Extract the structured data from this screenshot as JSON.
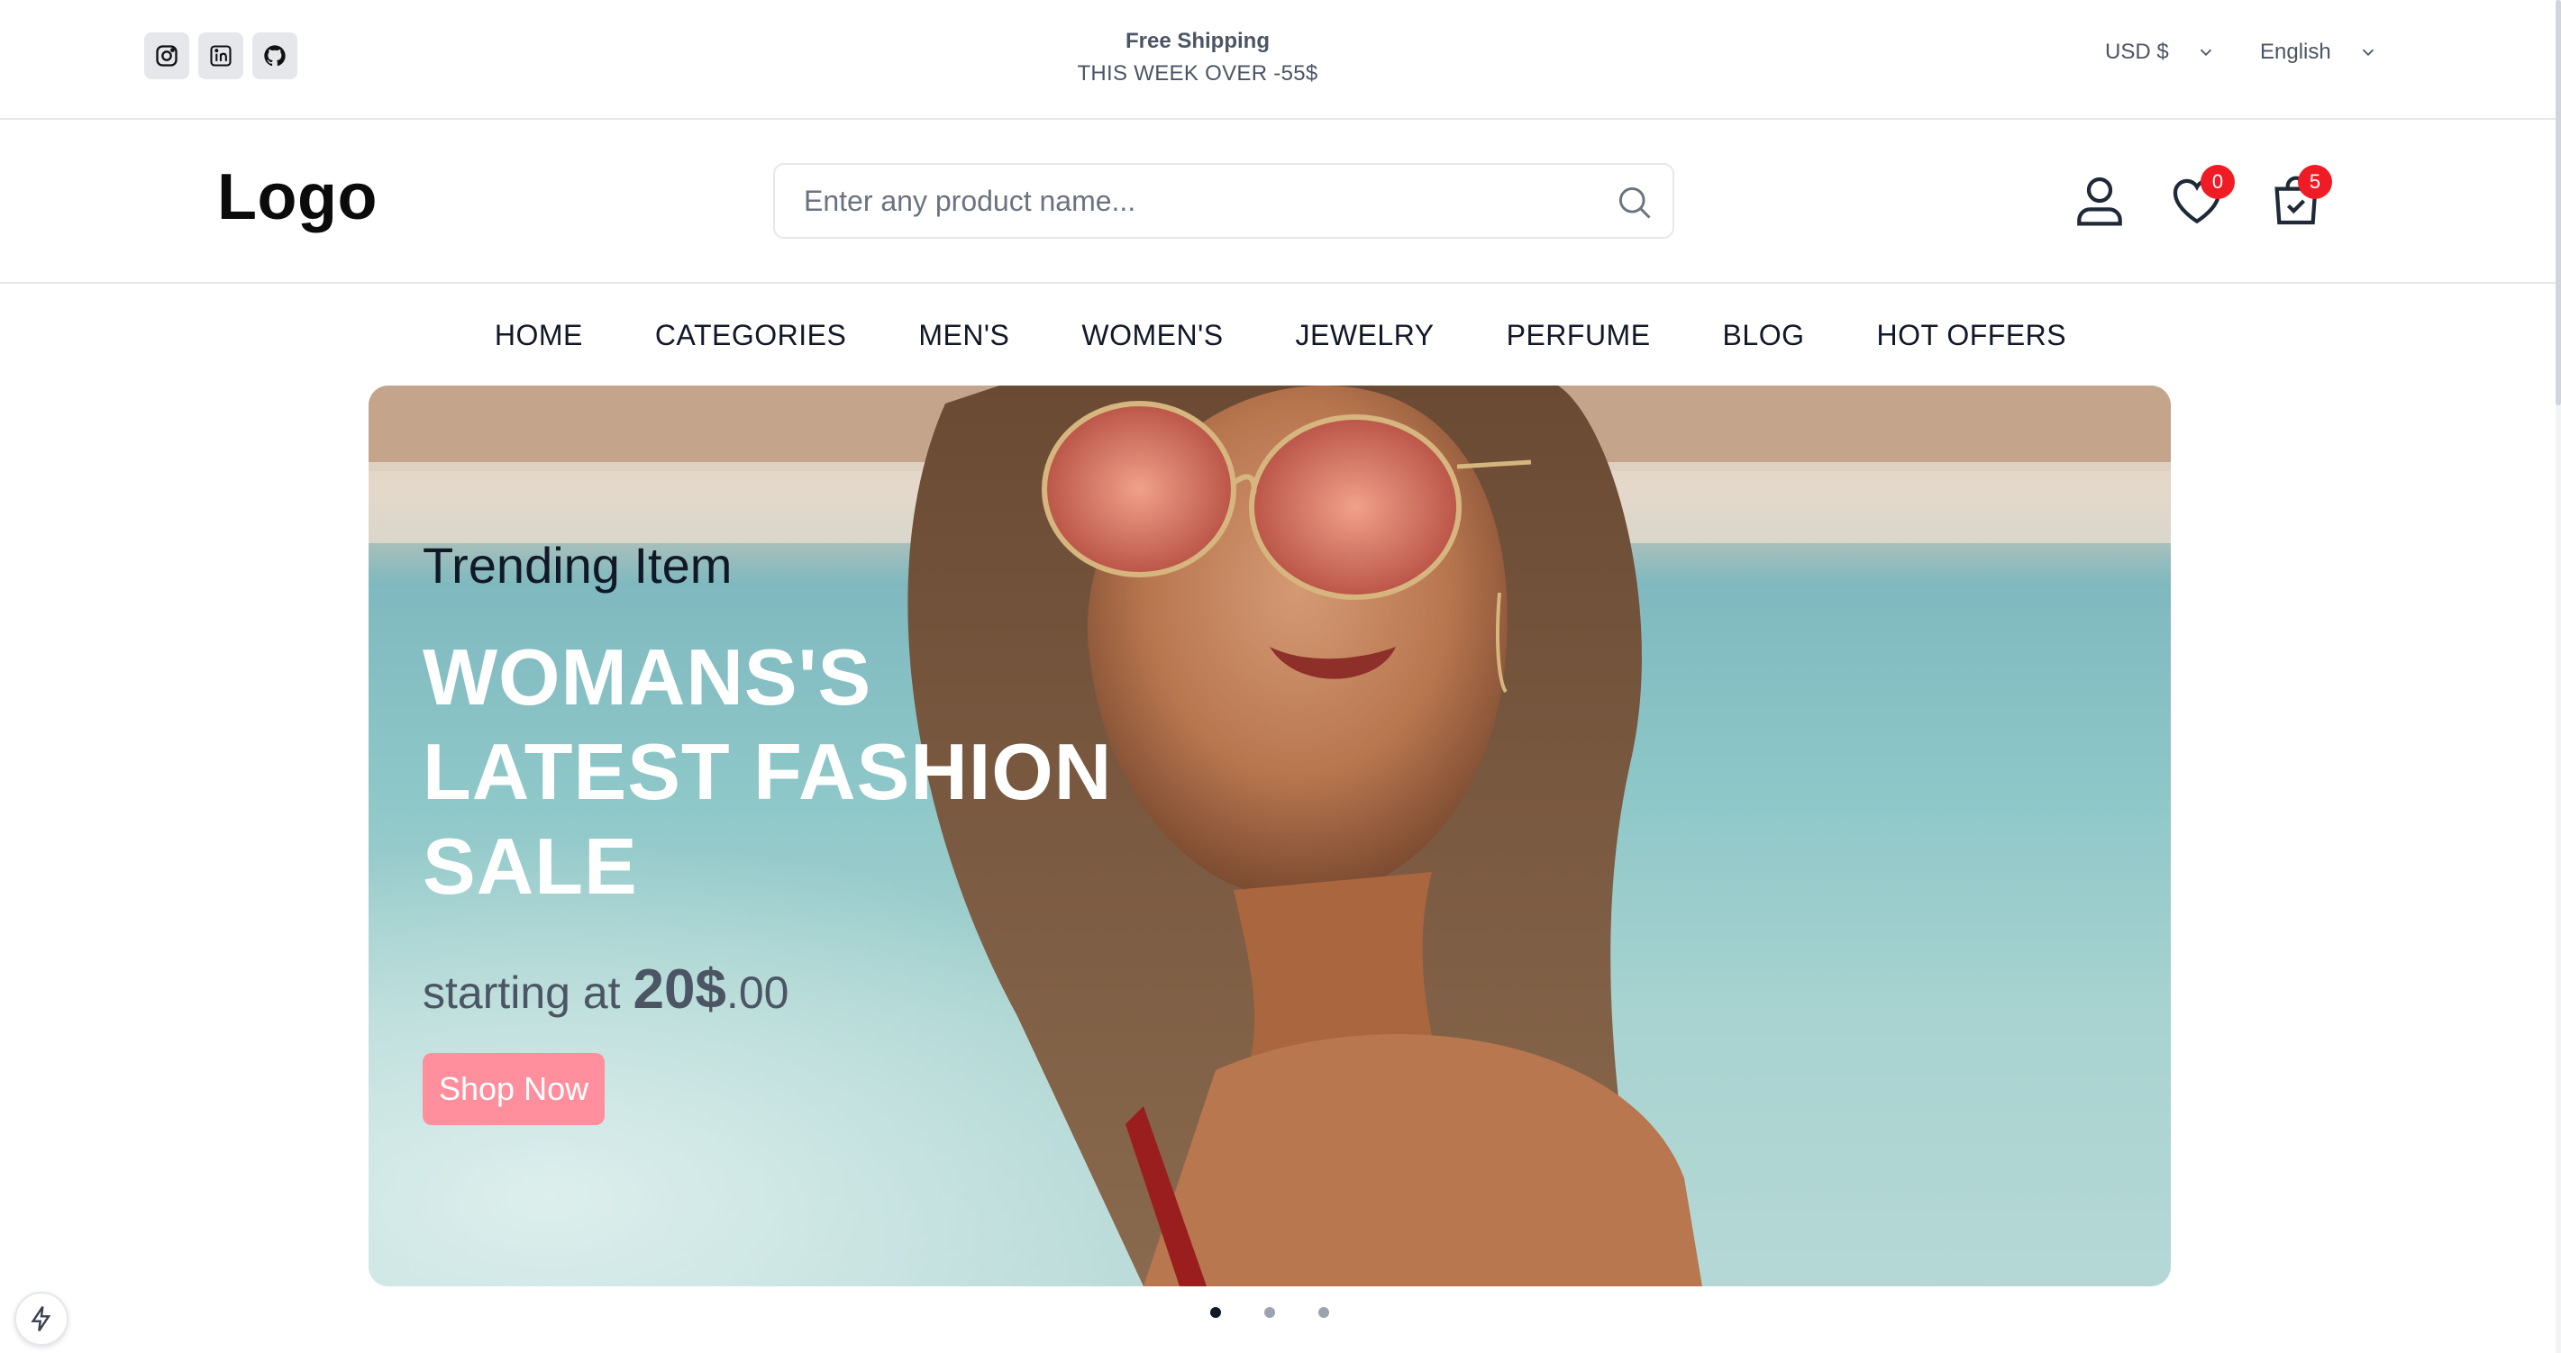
{
  "topbar": {
    "socials": [
      {
        "icon": "instagram-icon"
      },
      {
        "icon": "linkedin-icon"
      },
      {
        "icon": "github-icon"
      }
    ],
    "shipping_title": "Free Shipping",
    "shipping_subtitle": "THIS WEEK OVER -55$",
    "currency": "USD $",
    "language": "English"
  },
  "header": {
    "logo": "Logo",
    "search_placeholder": "Enter any product name...",
    "wishlist_count": "0",
    "cart_count": "5"
  },
  "nav": [
    "HOME",
    "CATEGORIES",
    "MEN'S",
    "WOMEN'S",
    "JEWELRY",
    "PERFUME",
    "BLOG",
    "HOT OFFERS"
  ],
  "hero": {
    "eyebrow": "Trending Item",
    "title": "WOMANS'S LATEST FASHION SALE",
    "price_prefix": "starting at",
    "price_main": "20$",
    "price_cents": ".00",
    "cta": "Shop Now"
  },
  "carousel": {
    "slides": 3,
    "active_slide": 1
  },
  "colors": {
    "accent": "#ff8f9c",
    "badge": "#ef1c25",
    "text": "#111827",
    "muted": "#4b5563",
    "border": "#e5e7eb"
  }
}
